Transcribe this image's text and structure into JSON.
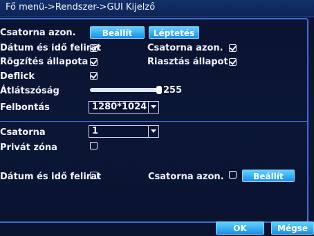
{
  "title": "Fő menü->Rendszer->GUI Kijelző",
  "rows": {
    "channel_name": {
      "label": "Csatorna azon.",
      "set_button": "Beállít",
      "step_button": "Léptetés"
    },
    "datetime_overlay": {
      "label": "Dátum és idő felirat",
      "checked": true
    },
    "recording_status": {
      "label": "Rögzítés állapota",
      "checked": true
    },
    "deflicker": {
      "label": "Deflick",
      "checked": true
    },
    "channel_name_right": {
      "label": "Csatorna azon.",
      "checked": true
    },
    "alarm_status": {
      "label": "Riasztás állapot",
      "checked": true
    },
    "transparency": {
      "label": "Átlátszóság",
      "value": 255,
      "fraction": 1.0
    },
    "resolution": {
      "label": "Felbontás",
      "value": "1280*1024"
    }
  },
  "section2": {
    "channel": {
      "label": "Csatorna",
      "value": "1"
    },
    "privacy_zone": {
      "label": "Privát zóna",
      "checked": false
    },
    "datetime_overlay2": {
      "label": "Dátum és idő felirat",
      "checked": false
    },
    "channel_name2": {
      "label": "Csatorna azon.",
      "checked": false,
      "set_button": "Beállít"
    }
  },
  "footer": {
    "ok": "OK",
    "cancel": "Mégse"
  }
}
